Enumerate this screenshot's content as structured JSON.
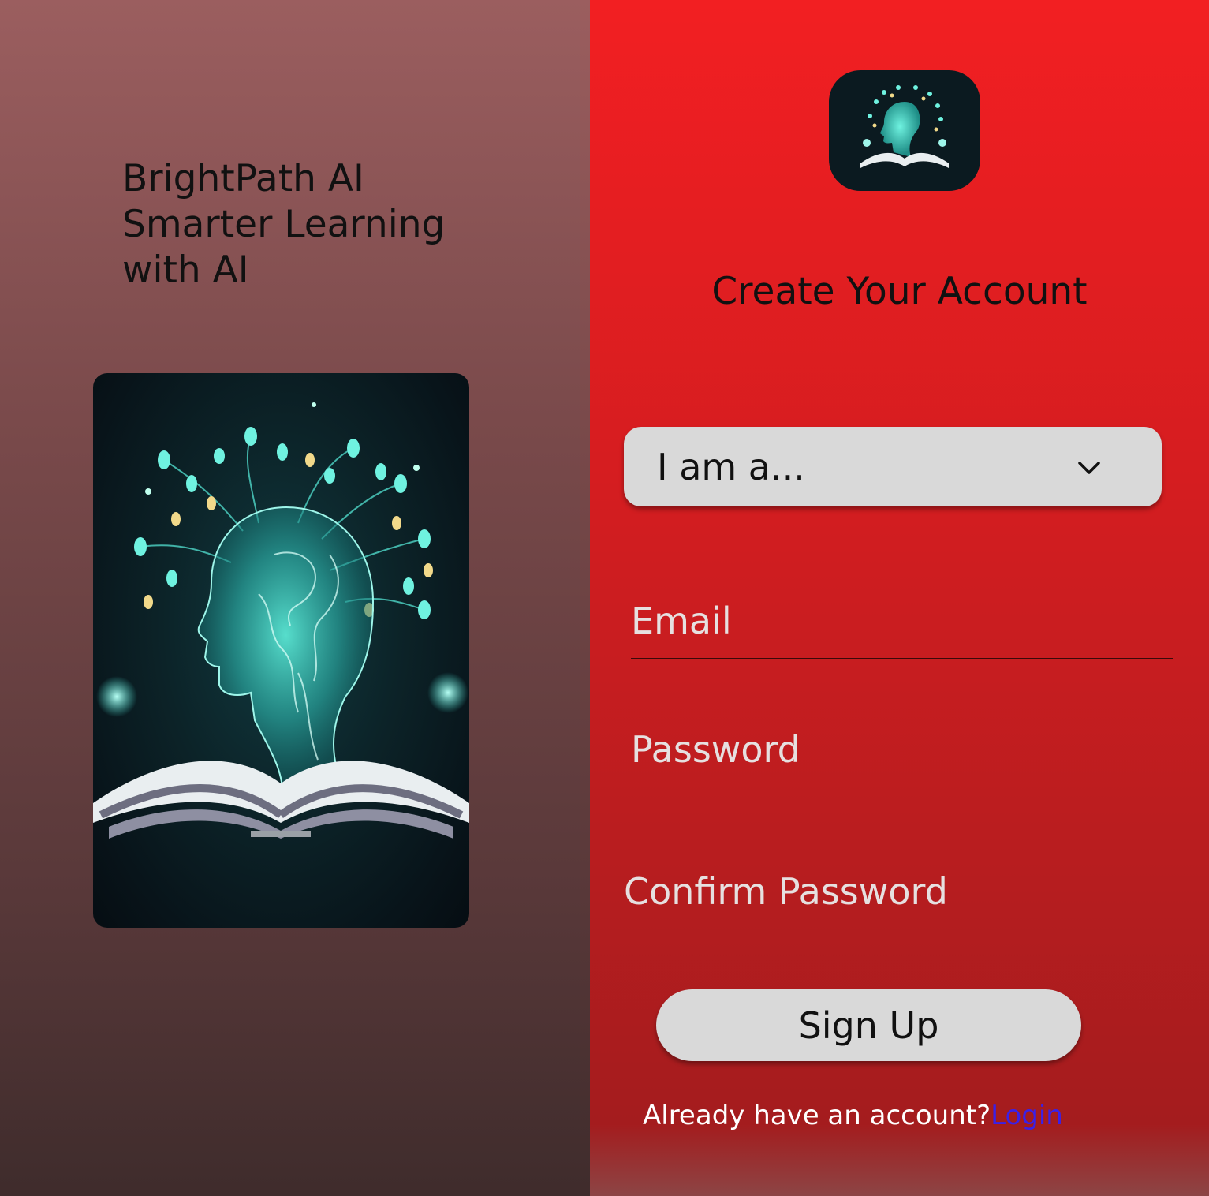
{
  "brand": {
    "tagline_lines": [
      "BrightPath AI",
      "Smarter Learning",
      "with AI"
    ]
  },
  "hero": {
    "image": "ai-head-book-illustration"
  },
  "logo": {
    "image": "ai-head-book-logo"
  },
  "form": {
    "title": "Create Your Account",
    "role_select": {
      "selected": "I am a...",
      "icon": "chevron-down-icon"
    },
    "email_placeholder": "Email",
    "password_placeholder": "Password",
    "confirm_password_placeholder": "Confirm Password",
    "submit_label": "Sign Up",
    "login_prompt": "Already have an account?",
    "login_link": "Login"
  },
  "colors": {
    "left_panel": "#8a5354",
    "right_panel": "#e11f22",
    "button_bg": "#d9d9d9",
    "link": "#3a20e8",
    "accent_glow": "#3fe0d0"
  }
}
